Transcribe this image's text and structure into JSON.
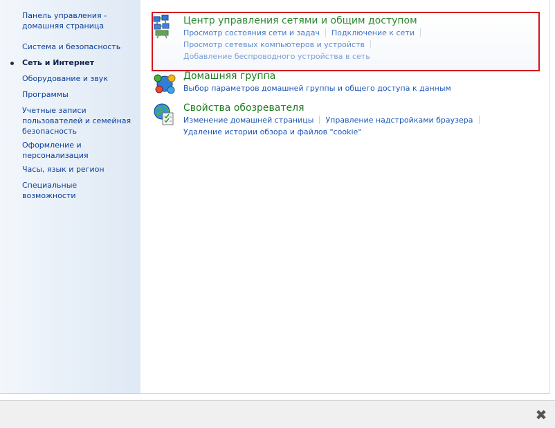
{
  "sidebar": {
    "items": [
      {
        "label": "Панель управления - домашняя страница"
      },
      {
        "label": "Система и безопасность"
      },
      {
        "label": "Сеть и Интернет"
      },
      {
        "label": "Оборудование и звук"
      },
      {
        "label": "Программы"
      },
      {
        "label": "Учетные записи пользователей и семейная безопасность"
      },
      {
        "label": "Оформление и персонализация"
      },
      {
        "label": "Часы, язык и регион"
      },
      {
        "label": "Специальные возможности"
      }
    ]
  },
  "categories": [
    {
      "icon": "network-center-icon",
      "title": "Центр управления сетями и общим доступом",
      "links": [
        "Просмотр состояния сети и задач",
        "Подключение к сети",
        "Просмотр сетевых компьютеров и устройств",
        "Добавление беспроводного устройства в сеть"
      ]
    },
    {
      "icon": "homegroup-icon",
      "title": "Домашняя группа",
      "links": [
        "Выбор параметров домашней группы и общего доступа к данным"
      ]
    },
    {
      "icon": "internet-options-icon",
      "title": "Свойства обозревателя",
      "links": [
        "Изменение домашней страницы",
        "Управление надстройками браузера",
        "Удаление истории обзора и файлов \"cookie\""
      ]
    }
  ],
  "colors": {
    "highlight_border": "#d4151c",
    "category_title": "#1e7d1e",
    "link": "#1a56b6"
  }
}
